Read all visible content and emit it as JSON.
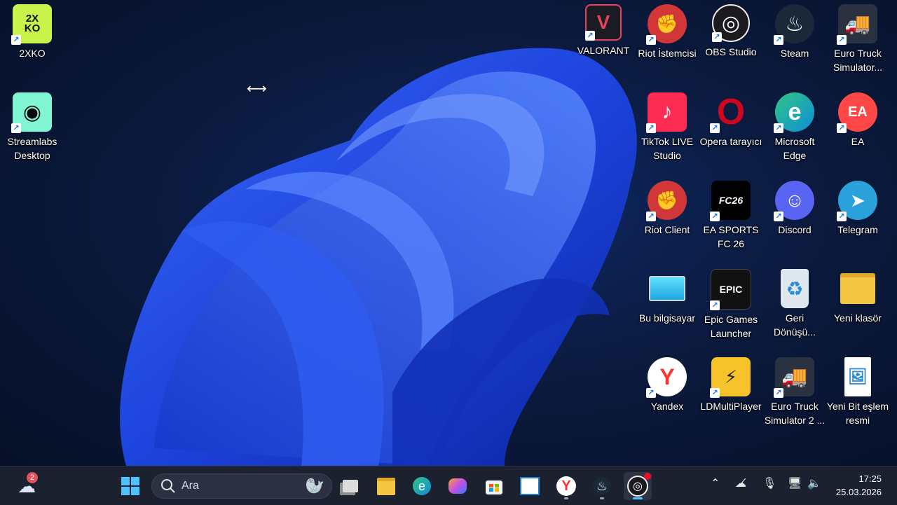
{
  "desktop": {
    "left_icons": [
      {
        "label": "2XKO",
        "icon": "2xko-icon",
        "glyph": "2X\nKO"
      },
      {
        "label": "Streamlabs\nDesktop",
        "icon": "streamlabs-icon",
        "glyph": "◉"
      }
    ],
    "grid_icons": [
      {
        "label": "VALORANT",
        "icon": "valorant-icon",
        "glyph": "V"
      },
      {
        "label": "Riot İstemcisi",
        "icon": "riot-client-icon",
        "glyph": "✊"
      },
      {
        "label": "OBS Studio",
        "icon": "obs-icon",
        "glyph": "◎"
      },
      {
        "label": "Steam",
        "icon": "steam-icon",
        "glyph": "♨"
      },
      {
        "label": "Euro Truck\nSimulator...",
        "icon": "euro-truck-icon",
        "glyph": "🚚"
      },
      {
        "label": "TikTok LIVE\nStudio",
        "icon": "tiktok-live-icon",
        "glyph": "♪"
      },
      {
        "label": "Opera tarayıcı",
        "icon": "opera-icon",
        "glyph": "O"
      },
      {
        "label": "Microsoft\nEdge",
        "icon": "edge-icon",
        "glyph": "e"
      },
      {
        "label": "EA",
        "icon": "ea-icon",
        "glyph": "EA"
      },
      {
        "label": "Riot Client",
        "icon": "riot-client-2-icon",
        "glyph": "✊"
      },
      {
        "label": "EA SPORTS\nFC 26",
        "icon": "fc26-icon",
        "glyph": "FC26"
      },
      {
        "label": "Discord",
        "icon": "discord-icon",
        "glyph": "☺"
      },
      {
        "label": "Telegram",
        "icon": "telegram-icon",
        "glyph": "➤"
      },
      {
        "label": "Bu bilgisayar",
        "icon": "this-pc-icon",
        "glyph": "▭"
      },
      {
        "label": "Epic Games\nLauncher",
        "icon": "epic-games-icon",
        "glyph": "EPIC"
      },
      {
        "label": "Geri\nDönüşü...",
        "icon": "recycle-bin-icon",
        "glyph": "♻"
      },
      {
        "label": "Yeni klasör",
        "icon": "folder-icon",
        "glyph": ""
      },
      {
        "label": "Yandex",
        "icon": "yandex-icon",
        "glyph": "Y"
      },
      {
        "label": "LDMultiPlayer",
        "icon": "ldmultiplayer-icon",
        "glyph": "⚡"
      },
      {
        "label": "Euro Truck\nSimulator 2 ...",
        "icon": "euro-truck-2-icon",
        "glyph": "🚚"
      },
      {
        "label": "Yeni Bit eşlem\nresmi",
        "icon": "bitmap-file-icon",
        "glyph": "🖼"
      }
    ]
  },
  "colors": {
    "valorant": "#1b1b24",
    "riot": "#d13639",
    "obs": "#1b1b1f",
    "steam": "#1b2838",
    "truck": "#2a3242",
    "tiktok": "#fe2c55",
    "opera": "#d0061e",
    "edge": "#0c8fdc",
    "ea": "#ff4747",
    "fc26": "#000000",
    "discord": "#5865f2",
    "telegram": "#2aa1da",
    "pc": "#1ea6e0",
    "epic": "#111111",
    "bin": "#dfe8ef",
    "folder": "#f4c542",
    "yandex": "#ffffff",
    "ld": "#f6c42a",
    "bitmap": "#ffffff",
    "xko": "#c9f24a",
    "streamlabs": "#80f5d2"
  },
  "taskbar": {
    "weather_badge": "2",
    "search_placeholder": "Ara",
    "clock_time": "17:25",
    "clock_date": "25.03.2026",
    "tray_icons": [
      "chevron-up-icon",
      "cloud-off-icon",
      "microphone-icon",
      "network-icon",
      "speaker-icon"
    ]
  }
}
